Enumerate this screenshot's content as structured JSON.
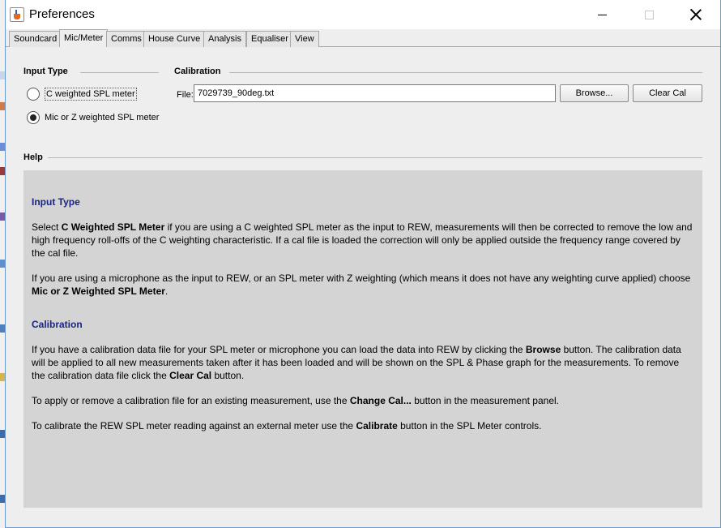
{
  "window": {
    "title": "Preferences"
  },
  "tabs": [
    {
      "label": "Soundcard"
    },
    {
      "label": "Mic/Meter"
    },
    {
      "label": "Comms"
    },
    {
      "label": "House Curve"
    },
    {
      "label": "Analysis"
    },
    {
      "label": "Equaliser"
    },
    {
      "label": "View"
    }
  ],
  "input_type": {
    "title": "Input Type",
    "options": [
      {
        "label": "C weighted SPL meter",
        "checked": false
      },
      {
        "label": "Mic or Z weighted SPL meter",
        "checked": true
      }
    ]
  },
  "calibration": {
    "title": "Calibration",
    "file_label": "File:",
    "file_value": "7029739_90deg.txt",
    "browse_label": "Browse...",
    "clear_label": "Clear Cal"
  },
  "help": {
    "title": "Help",
    "input_type_heading": "Input Type",
    "p1_a": "Select ",
    "p1_b": "C Weighted SPL Meter",
    "p1_c": " if you are using a C weighted SPL meter as the input to REW, measurements will then be corrected to remove the low and high frequency roll-offs of the C weighting characteristic. If a cal file is loaded the correction will only be applied outside the frequency range covered by the cal file.",
    "p2_a": "If you are using a microphone as the input to REW, or an SPL meter with Z weighting (which means it does not have any weighting curve applied) choose ",
    "p2_b": "Mic or Z Weighted SPL Meter",
    "p2_c": ".",
    "calibration_heading": "Calibration",
    "p3_a": "If you have a calibration data file for your SPL meter or microphone you can load the data into REW by clicking the ",
    "p3_b": "Browse",
    "p3_c": " button. The calibration data will be applied to all new measurements taken after it has been loaded and will be shown on the SPL & Phase graph for the measurements. To remove the calibration data file click the ",
    "p3_d": "Clear Cal",
    "p3_e": " button.",
    "p4_a": "To apply or remove a calibration file for an existing measurement, use the ",
    "p4_b": "Change Cal...",
    "p4_c": " button in the measurement panel.",
    "p5_a": "To calibrate the REW SPL meter reading against an external meter use the ",
    "p5_b": "Calibrate",
    "p5_c": " button in the SPL Meter controls."
  }
}
